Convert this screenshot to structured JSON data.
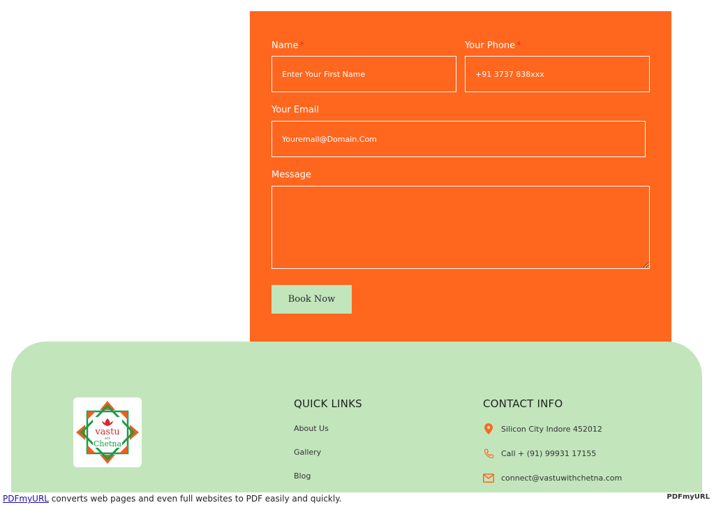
{
  "form": {
    "name_label": "Name",
    "phone_label": "Your Phone",
    "required_mark": "*",
    "email_label": "Your Email",
    "message_label": "Message",
    "name_placeholder": "Enter Your First Name",
    "phone_placeholder": "+91 3737 838xxx",
    "email_placeholder": "Youremail@Domain.Com",
    "message_placeholder": "",
    "submit_label": "Book Now"
  },
  "footer": {
    "logo_text_top": "vastu",
    "logo_text_mid": "with",
    "logo_text_bottom": "Chetna",
    "quick_links_title": "QUICK LINKS",
    "quick_links": [
      "About Us",
      "Gallery",
      "Blog"
    ],
    "contact_title": "CONTACT INFO",
    "contact": {
      "address": "Silicon City Indore 452012",
      "phone": "Call + (91) 99931 17155",
      "email": "connect@vastuwithchetna.com"
    }
  },
  "bottom_bar": {
    "link_text": "PDFmyURL",
    "text": " converts web pages and even full websites to PDF easily and quickly.",
    "logo": "PDFmyURL"
  },
  "colors": {
    "form_bg": "#ff661e",
    "footer_bg": "#c2e5bc",
    "button_bg": "#c2e5bc",
    "icon_orange": "#ff661e"
  }
}
